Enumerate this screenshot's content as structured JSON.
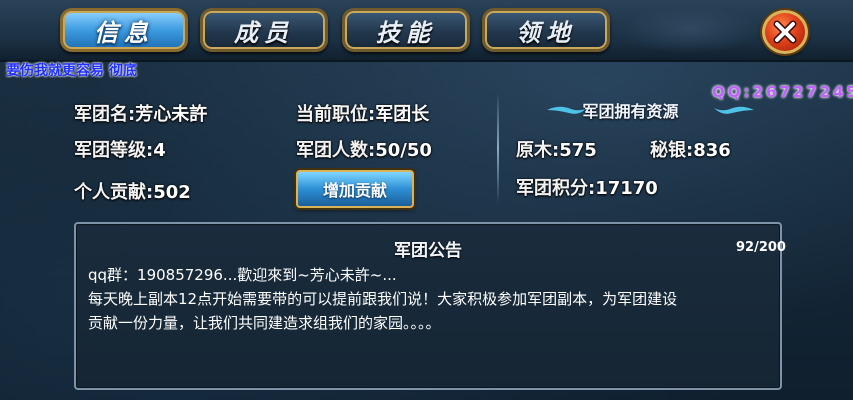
{
  "tabs": [
    {
      "label": "信息",
      "active": true
    },
    {
      "label": "成员",
      "active": false
    },
    {
      "label": "技能",
      "active": false
    },
    {
      "label": "领地",
      "active": false
    }
  ],
  "overlay": {
    "caption": "要伤我就更容易 彻底",
    "watermark": "QQ:26727245"
  },
  "guild": {
    "name_label": "军团名:",
    "name": "芳心未許",
    "position_label": "当前职位:",
    "position": "军团长",
    "level_label": "军团等级:",
    "level": "4",
    "members_label": "军团人数:",
    "members": "50/50",
    "contribution_label": "个人贡献:",
    "contribution": "502",
    "add_button": "增加贡献"
  },
  "resources": {
    "title": "军团拥有资源",
    "wood_label": "原木:",
    "wood": "575",
    "silver_label": "秘银:",
    "silver": "836",
    "points_label": "军团积分:",
    "points": "17170"
  },
  "notice": {
    "title": "军团公告",
    "count": "92/200",
    "line1": "qq群：190857296...歡迎來到~芳心未許~...",
    "line2": "每天晚上副本12点开始需要带的可以提前跟我们说！大家积极参加军团副本，为军团建设",
    "line3": "贡献一份力量，让我们共同建造求组我们的家园。。。。"
  },
  "colors": {
    "tab_active": "#3d9be0",
    "tab_inactive": "#23384d",
    "close_button": "#e0421a",
    "gold_border": "#d9b25a",
    "caption": "#1e2fff",
    "watermark": "#c060ff"
  },
  "icons": {
    "close": "close-x-icon",
    "ornament": "wing-ornament-icon"
  }
}
